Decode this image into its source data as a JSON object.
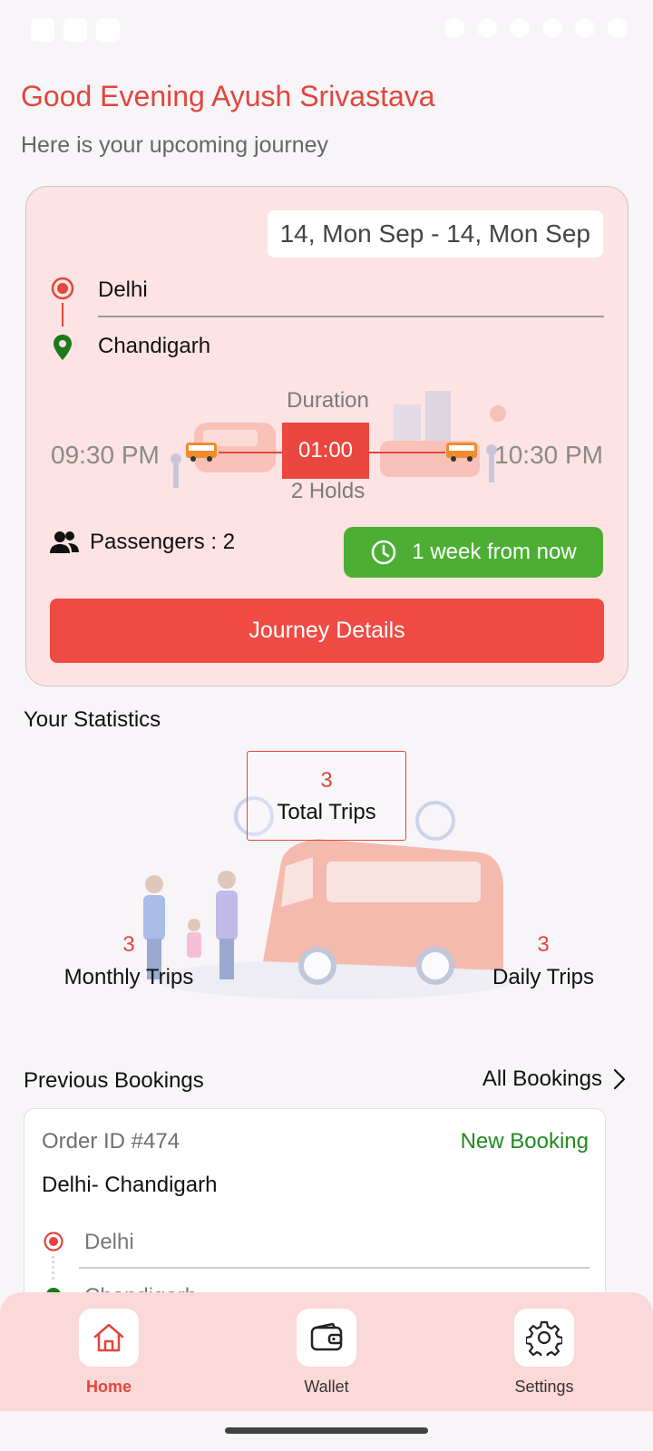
{
  "header": {
    "greeting": "Good Evening Ayush Srivastava",
    "subtitle": "Here is your upcoming journey"
  },
  "journey": {
    "date_range": "14, Mon Sep - 14, Mon Sep",
    "from": "Delhi",
    "to": "Chandigarh",
    "duration_label": "Duration",
    "departure_time": "09:30 PM",
    "arrival_time": "10:30 PM",
    "duration": "01:00",
    "holds": "2 Holds",
    "passengers": "Passengers : 2",
    "countdown": "1 week from now",
    "details_button": "Journey Details"
  },
  "statistics": {
    "title": "Your Statistics",
    "total": {
      "value": "3",
      "label": "Total Trips"
    },
    "monthly": {
      "value": "3",
      "label": "Monthly Trips"
    },
    "daily": {
      "value": "3",
      "label": "Daily Trips"
    }
  },
  "bookings": {
    "title": "Previous Bookings",
    "all_link": "All Bookings",
    "items": [
      {
        "order_id": "Order ID #474",
        "status": "New Booking",
        "route": "Delhi- Chandigarh",
        "from": "Delhi",
        "to": "Chandigarh"
      }
    ]
  },
  "nav": {
    "items": [
      {
        "label": "Home",
        "icon": "home-icon",
        "active": true
      },
      {
        "label": "Wallet",
        "icon": "wallet-icon",
        "active": false
      },
      {
        "label": "Settings",
        "icon": "gear-icon",
        "active": false
      }
    ]
  },
  "colors": {
    "accent": "#e2463c",
    "button": "#ef4b44",
    "card_bg": "#fde3e3",
    "success": "#4caf34",
    "status_green": "#1f8a1f",
    "nav_bg": "#fbd9d8"
  }
}
